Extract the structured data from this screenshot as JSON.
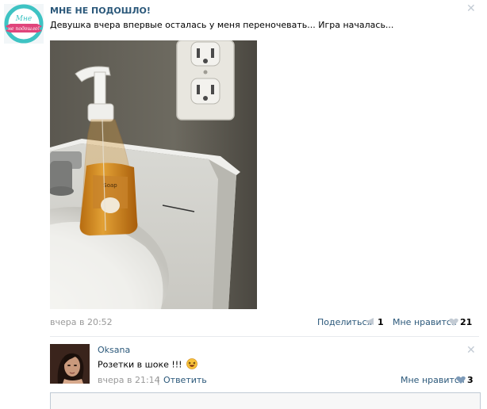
{
  "post": {
    "author": "МНЕ НЕ ПОДОШЛО!",
    "avatar_text": "Мне не подошло!",
    "text": "Девушка вчера впервые осталась у меня переночевать... Игра началась...",
    "time": "вчера в 20:52",
    "share_label": "Поделиться",
    "share_count": "1",
    "like_label": "Мне нравится",
    "like_count": "21",
    "photo_label": "Soap"
  },
  "comment": {
    "author": "Oksana",
    "text": "Розетки в шоке !!!",
    "time": "вчера в 21:14",
    "separator": "|",
    "reply_label": "Ответить",
    "like_label": "Мне нравится",
    "like_count": "3"
  },
  "icons": {
    "close": "close-icon",
    "share": "megaphone-icon",
    "heart": "heart-icon",
    "emoji": "laughing-emoji-icon"
  },
  "colors": {
    "link": "#2b587a",
    "muted": "#999999",
    "icon": "#c3cbd4",
    "avatar_ring": "#3ec3c3",
    "avatar_ribbon": "#e0457b"
  }
}
